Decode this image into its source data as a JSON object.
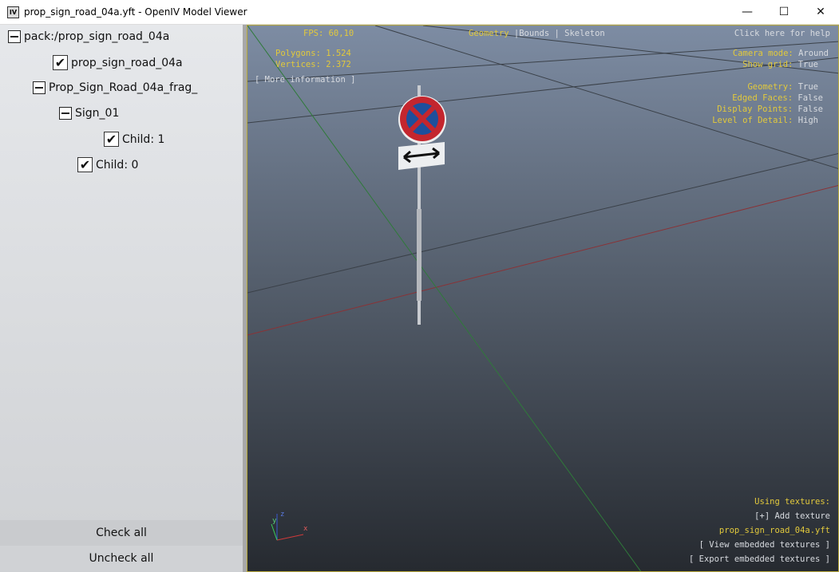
{
  "window": {
    "title": "prop_sign_road_04a.yft - OpenIV Model Viewer",
    "icon": "IV",
    "minimize": "—",
    "maximize": "☐",
    "close": "✕"
  },
  "tree": [
    {
      "label": "pack:/prop_sign_road_04a",
      "type": "expander"
    },
    {
      "label": "prop_sign_road_04a",
      "type": "checkbox",
      "checked": true
    },
    {
      "label": "Prop_Sign_Road_04a_frag_",
      "type": "expander"
    },
    {
      "label": "Sign_01",
      "type": "expander"
    },
    {
      "label": "Child: 1",
      "type": "checkbox",
      "checked": true
    },
    {
      "label": "Child: 0",
      "type": "checkbox",
      "checked": true
    }
  ],
  "buttons": {
    "check_all": "Check all",
    "uncheck_all": "Uncheck all"
  },
  "overlay": {
    "fps": "FPS: 60,10",
    "polygons": "Polygons: 1.524",
    "vertices": "Vertices: 2.372",
    "more_info": "[ More information ]",
    "modes": {
      "geometry": "Geometry",
      "bounds": "Bounds",
      "skeleton": "Skeleton",
      "sep": "|"
    },
    "help": "Click here for help",
    "camera_label": "Camera mode:",
    "camera_value": "Around",
    "grid_label": "Show grid:",
    "grid_value": "True",
    "geometry_label": "Geometry:",
    "geometry_value": "True",
    "edged_label": "Edged Faces:",
    "edged_value": "False",
    "points_label": "Display Points:",
    "points_value": "False",
    "lod_label": "Level of Detail:",
    "lod_value": "High",
    "textures_label": "Using textures:",
    "add_texture": "[+] Add texture",
    "texture_file": "prop_sign_road_04a.yft",
    "view_embedded": "[ View embedded textures ]",
    "export_embedded": "[ Export embedded textures ]",
    "axes": {
      "x": "x",
      "y": "y",
      "z": "z"
    }
  }
}
